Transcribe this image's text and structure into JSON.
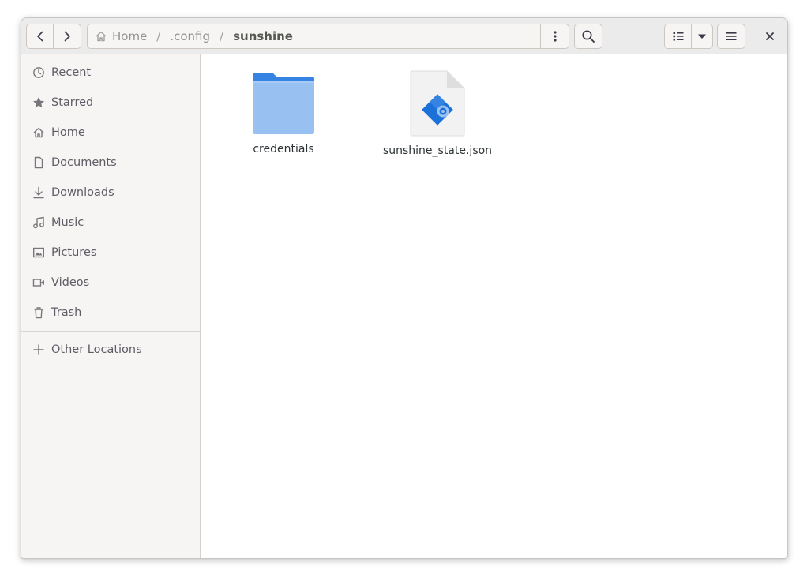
{
  "header": {
    "breadcrumbs": [
      {
        "label": "Home",
        "icon": "home-icon"
      },
      {
        "label": ".config"
      },
      {
        "label": "sunshine"
      }
    ],
    "separator": "/"
  },
  "sidebar": {
    "items": [
      {
        "label": "Recent",
        "icon": "clock-icon"
      },
      {
        "label": "Starred",
        "icon": "star-icon"
      },
      {
        "label": "Home",
        "icon": "home-icon"
      },
      {
        "label": "Documents",
        "icon": "document-icon"
      },
      {
        "label": "Downloads",
        "icon": "download-icon"
      },
      {
        "label": "Music",
        "icon": "music-icon"
      },
      {
        "label": "Pictures",
        "icon": "picture-icon"
      },
      {
        "label": "Videos",
        "icon": "video-icon"
      },
      {
        "label": "Trash",
        "icon": "trash-icon"
      }
    ],
    "other": {
      "label": "Other Locations",
      "icon": "plus-icon"
    }
  },
  "files": [
    {
      "name": "credentials",
      "type": "folder",
      "icon": "folder-icon"
    },
    {
      "name": "sunshine_state.json",
      "type": "json",
      "icon": "json-file-icon"
    }
  ],
  "colors": {
    "folder_top": "#3584e4",
    "folder_body": "#98c1f1",
    "json_accent": "#1c71d8"
  }
}
